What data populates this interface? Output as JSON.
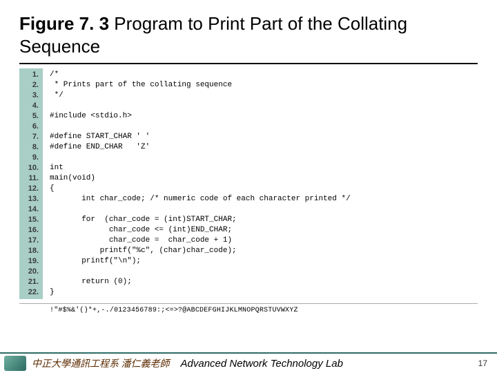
{
  "title": {
    "label_bold": "Figure 7. 3",
    "label_plain": "  Program to Print Part of the Collating Sequence"
  },
  "code": {
    "lines": [
      "/*",
      " * Prints part of the collating sequence",
      " */",
      "",
      "#include <stdio.h>",
      "",
      "#define START_CHAR ' '",
      "#define END_CHAR   'Z'",
      "",
      "int",
      "main(void)",
      "{",
      "       int char_code; /* numeric code of each character printed */",
      "",
      "       for  (char_code = (int)START_CHAR;",
      "             char_code <= (int)END_CHAR;",
      "             char_code =  char_code + 1)",
      "           printf(\"%c\", (char)char_code);",
      "       printf(\"\\n\");",
      "",
      "       return (0);",
      "}"
    ],
    "line_numbers": [
      "1.",
      "2.",
      "3.",
      "4.",
      "5.",
      "6.",
      "7.",
      "8.",
      "9.",
      "10.",
      "11.",
      "12.",
      "13.",
      "14.",
      "15.",
      "16.",
      "17.",
      "18.",
      "19.",
      "20.",
      "21.",
      "22."
    ]
  },
  "output": " !\"#$%&'()*+,-./0123456789:;<=>?@ABCDEFGHIJKLMNOPQRSTUVWXYZ",
  "footer": {
    "cn": "中正大學通訊工程系 潘仁義老師",
    "en": "Advanced Network Technology Lab",
    "page": "17"
  }
}
